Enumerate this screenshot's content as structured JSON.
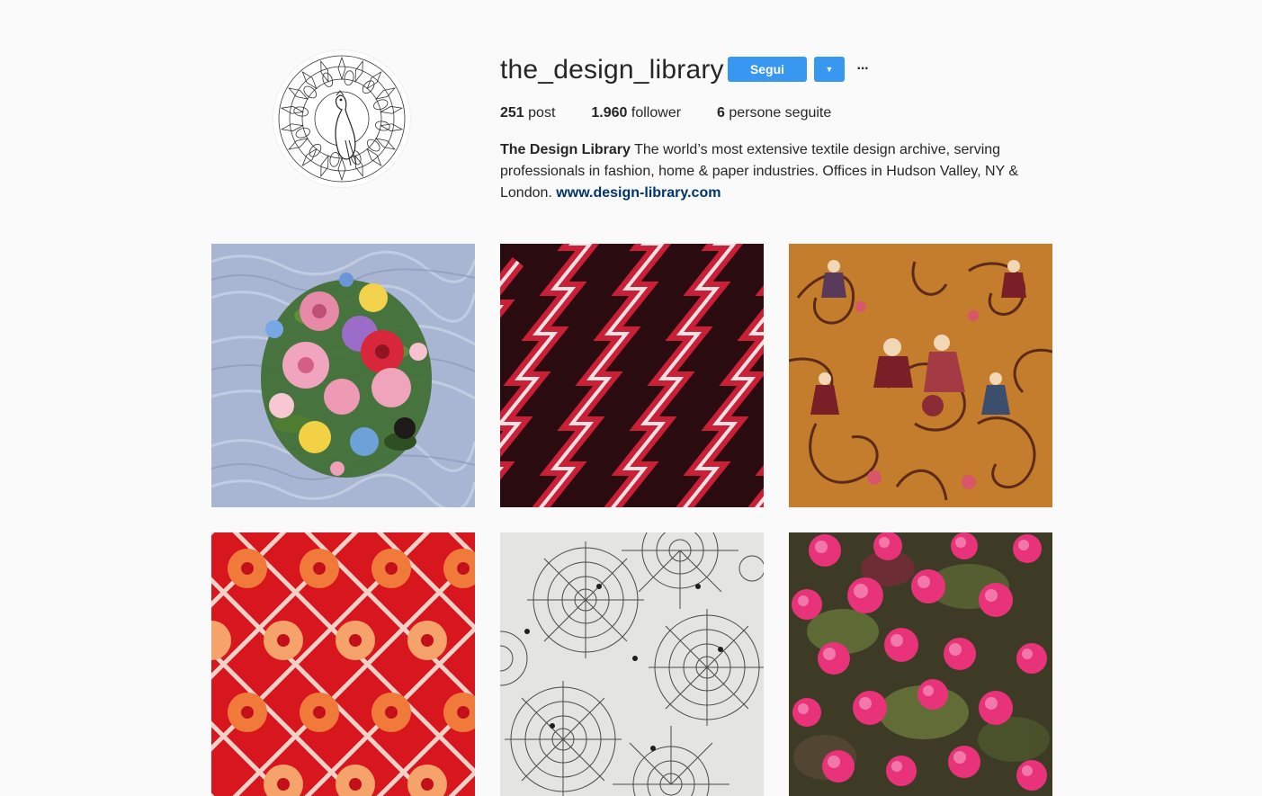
{
  "profile": {
    "username": "the_design_library",
    "follow_label": "Segui",
    "more_label": "···",
    "stats": {
      "posts_count": "251",
      "posts_label": "post",
      "followers_count": "1.960",
      "followers_label": "follower",
      "following_count": "6",
      "following_label": "persone seguite"
    },
    "bio": {
      "name": "The Design Library",
      "text": "The world’s most extensive textile design archive, serving professionals in fashion, home & paper industries. Offices in Hudson Valley, NY & London.",
      "link": "www.design-library.com"
    }
  },
  "colors": {
    "accent": "#3897f0",
    "link": "#003569",
    "background": "#fafafa",
    "text": "#262626"
  },
  "posts": [
    {
      "subject": "floral bouquet on blue moire"
    },
    {
      "subject": "red and white zigzag on black"
    },
    {
      "subject": "toile scene on ochre"
    },
    {
      "subject": "red geometric floral"
    },
    {
      "subject": "spider web print"
    },
    {
      "subject": "pink flower clusters"
    }
  ]
}
